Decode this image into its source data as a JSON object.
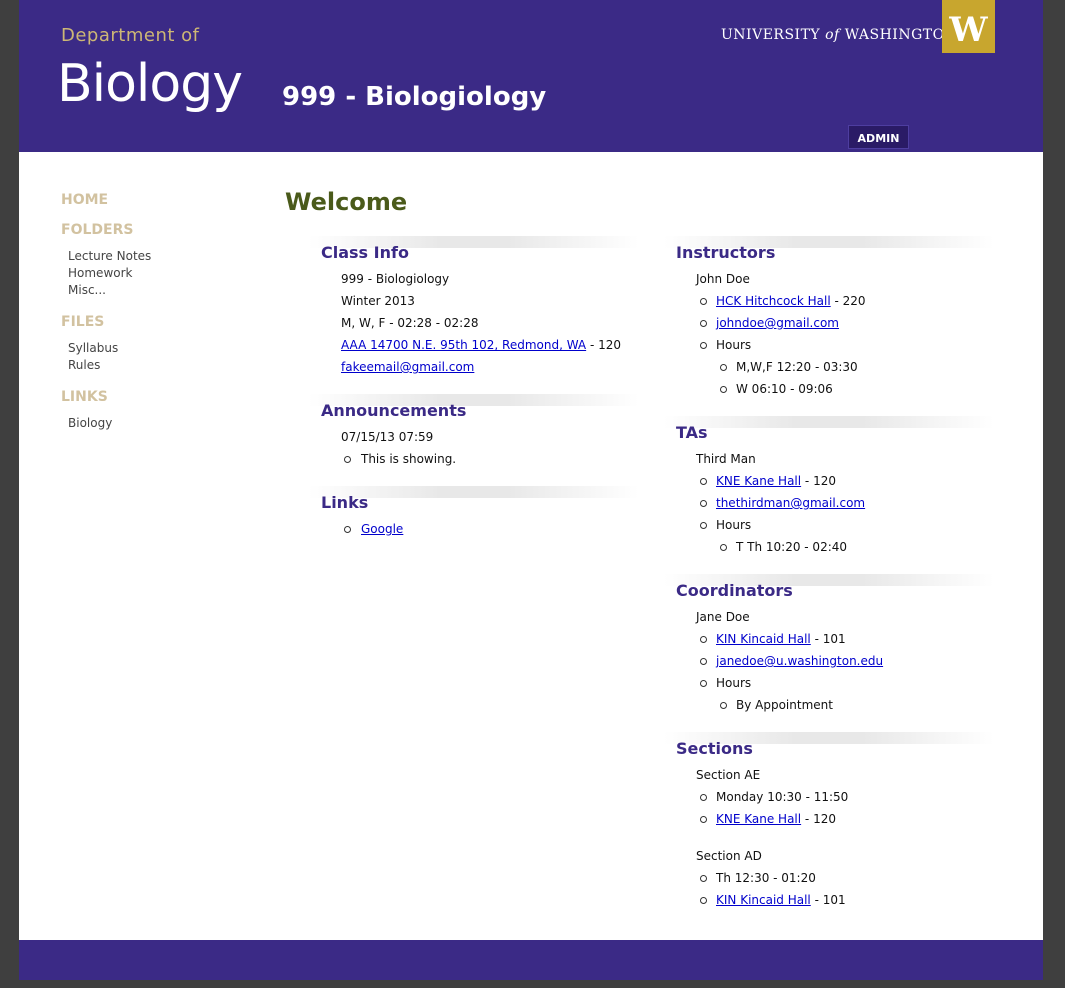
{
  "header": {
    "dept_prefix": "Department of",
    "dept_name": "Biology",
    "course_title": "999 - Biologiology",
    "university_pre": "UNIVERSITY",
    "university_of": "of",
    "university_post": "WASHINGTON",
    "logo_letter": "W",
    "admin_label": "ADMIN"
  },
  "nav": {
    "home": "HOME",
    "folders": "FOLDERS",
    "folder_items": [
      "Lecture Notes",
      "Homework",
      "Misc..."
    ],
    "files": "FILES",
    "file_items": [
      "Syllabus",
      "Rules"
    ],
    "links": "LINKS",
    "link_items": [
      "Biology"
    ]
  },
  "main": {
    "welcome": "Welcome",
    "class_info": {
      "title": "Class Info",
      "course": "999 - Biologiology",
      "term": "Winter 2013",
      "schedule": "M, W, F - 02:28 - 02:28",
      "location_link": "AAA 14700 N.E. 95th 102, Redmond, WA",
      "location_suffix": " - 120",
      "email": "fakeemail@gmail.com"
    },
    "announcements": {
      "title": "Announcements",
      "date": "07/15/13 07:59",
      "item": "This is showing."
    },
    "links": {
      "title": "Links",
      "item": "Google"
    },
    "instructors": {
      "title": "Instructors",
      "name": "John Doe",
      "building_link": "HCK Hitchcock Hall",
      "room": " - 220",
      "email": "johndoe@gmail.com",
      "hours_label": "Hours",
      "hours": [
        "M,W,F 12:20 - 03:30",
        "W 06:10 - 09:06"
      ]
    },
    "tas": {
      "title": "TAs",
      "name": "Third Man",
      "building_link": "KNE Kane Hall",
      "room": " - 120",
      "email": "thethirdman@gmail.com",
      "hours_label": "Hours",
      "hours": [
        "T Th 10:20 - 02:40"
      ]
    },
    "coordinators": {
      "title": "Coordinators",
      "name": "Jane Doe",
      "building_link": "KIN Kincaid Hall",
      "room": " - 101",
      "email": "janedoe@u.washington.edu",
      "hours_label": "Hours",
      "hours": [
        "By Appointment"
      ]
    },
    "sections": {
      "title": "Sections",
      "items": [
        {
          "name": "Section AE",
          "time": "Monday 10:30 - 11:50",
          "building_link": "KNE Kane Hall",
          "room": " - 120"
        },
        {
          "name": "Section AD",
          "time": "Th 12:30 - 01:20",
          "building_link": "KIN Kincaid Hall",
          "room": " - 101"
        }
      ]
    }
  },
  "colors": {
    "purple": "#3b2a86",
    "gold": "#c8a62e",
    "olive": "#4a5a1a",
    "link": "#0000cc"
  }
}
